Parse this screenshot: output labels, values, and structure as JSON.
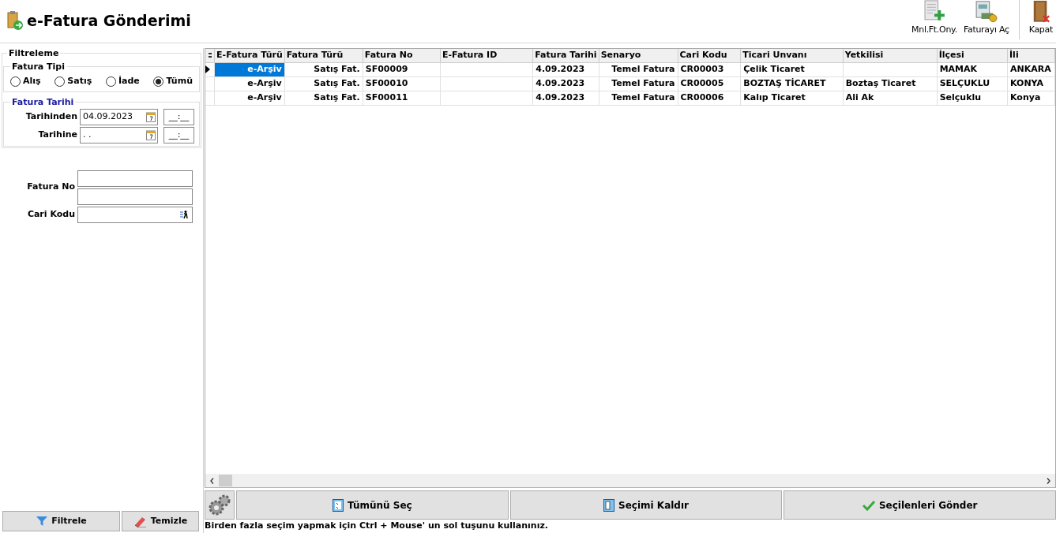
{
  "window": {
    "title": "e-Fatura Gönderimi"
  },
  "toolbar": [
    {
      "label": "Mnl.Ft.Ony.",
      "kind": "approve"
    },
    {
      "label": "Faturayı Aç",
      "kind": "open"
    },
    {
      "label": "Kapat",
      "kind": "close"
    }
  ],
  "filter": {
    "title": "Filtreleme",
    "invoice_type": {
      "title": "Fatura Tipi",
      "options": [
        {
          "label": "Alış",
          "selected": false
        },
        {
          "label": "Satış",
          "selected": false
        },
        {
          "label": "İade",
          "selected": false
        },
        {
          "label": "Tümü",
          "selected": true
        }
      ]
    },
    "invoice_date": {
      "title": "Fatura Tarihi",
      "fields": [
        {
          "label": "Tarihinden",
          "value": "04.09.2023",
          "time": "__:__"
        },
        {
          "label": "Tarihine",
          "value": ". .",
          "time": "__:__"
        }
      ]
    },
    "invoice_no_label": "Fatura No",
    "customer_code_label": "Cari Kodu",
    "buttons": [
      {
        "label": "Filtrele",
        "kind": "filter"
      },
      {
        "label": "Temizle",
        "kind": "clear"
      }
    ]
  },
  "table": {
    "columns": [
      "E-Fatura Türü",
      "Fatura Türü",
      "Fatura No",
      "E-Fatura ID",
      "Fatura Tarihi",
      "Senaryo",
      "Cari Kodu",
      "Ticari Unvanı",
      "Yetkilisi",
      "İlçesi",
      "İli"
    ],
    "rows": [
      {
        "selected": true,
        "cells": [
          "e-Arşiv",
          "Satış Fat.",
          "SF00009",
          "",
          "4.09.2023",
          "Temel Fatura",
          "CR00003",
          "Çelik Ticaret",
          "",
          "MAMAK",
          "ANKARA"
        ]
      },
      {
        "selected": false,
        "cells": [
          "e-Arşiv",
          "Satış Fat.",
          "SF00010",
          "",
          "4.09.2023",
          "Temel Fatura",
          "CR00005",
          "BOZTAŞ TİCARET",
          "Boztaş Ticaret",
          "SELÇUKLU",
          "KONYA"
        ]
      },
      {
        "selected": false,
        "cells": [
          "e-Arşiv",
          "Satış Fat.",
          "SF00011",
          "",
          "4.09.2023",
          "Temel Fatura",
          "CR00006",
          "Kalıp Ticaret",
          "Ali Ak",
          "Selçuklu",
          "Konya"
        ]
      }
    ]
  },
  "actions": [
    {
      "label": "Tümünü Seç",
      "kind": "select_all"
    },
    {
      "label": "Seçimi Kaldır",
      "kind": "deselect"
    },
    {
      "label": "Seçilenleri Gönder",
      "kind": "send"
    }
  ],
  "status_bar": "Birden fazla seçim yapmak için Ctrl + Mouse' un sol tuşunu kullanınız."
}
